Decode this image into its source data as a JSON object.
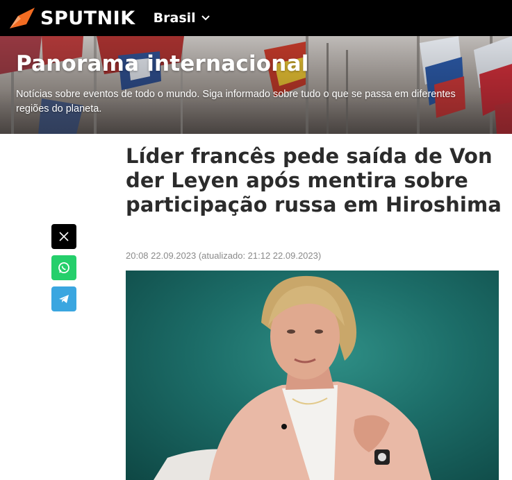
{
  "header": {
    "logo_text": "SPUTNIK",
    "edition": "Brasil",
    "logo_color": "#f26c22"
  },
  "banner": {
    "title": "Panorama internacional",
    "description": "Notícias sobre eventos de todo o mundo. Siga informado sobre tudo o que se passa em diferentes regiões do planeta."
  },
  "share": {
    "buttons": [
      {
        "icon": "x-icon",
        "color": "#000000"
      },
      {
        "icon": "whatsapp-icon",
        "color": "#25cf6b"
      },
      {
        "icon": "telegram-icon",
        "color": "#3aa6e0"
      }
    ]
  },
  "article": {
    "title": "Líder francês pede saída de Von der Leyen após mentira sobre participação russa em Hiroshima",
    "published": "20:08 22.09.2023",
    "updated": "(atualizado: 21:12 22.09.2023)"
  }
}
